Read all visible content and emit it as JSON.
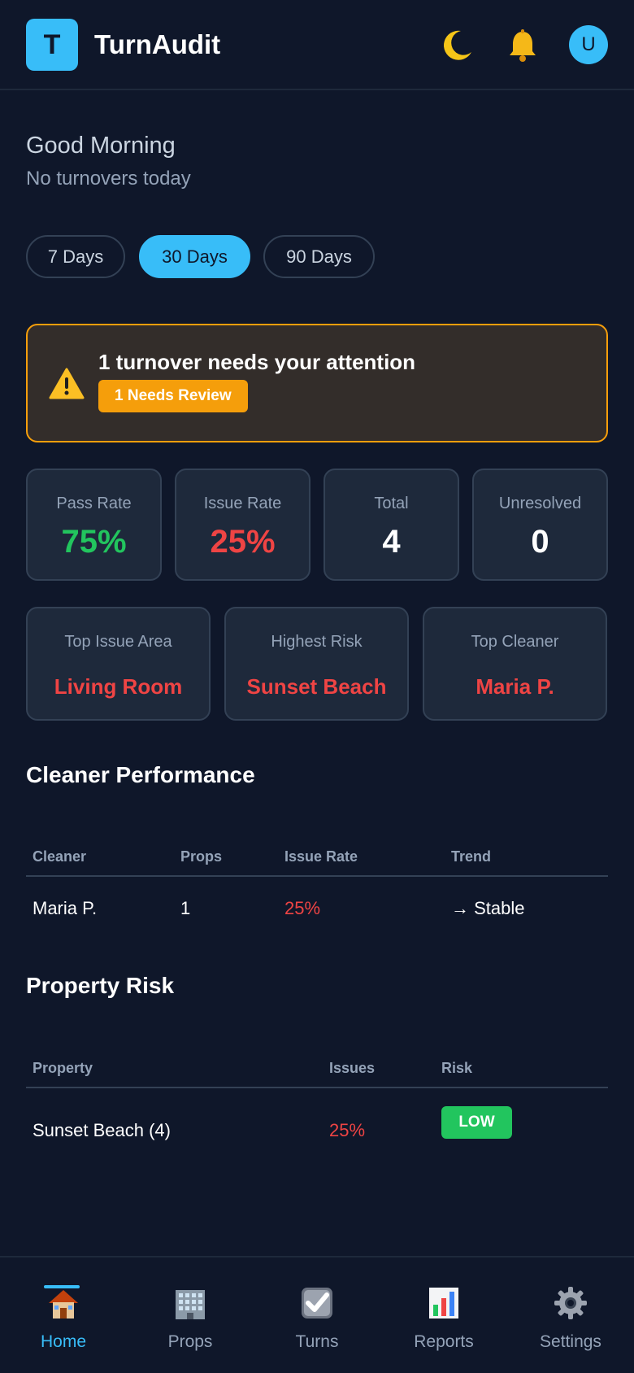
{
  "app": {
    "logo_letter": "T",
    "title": "TurnAudit",
    "avatar_letter": "U"
  },
  "greeting": {
    "title": "Good Morning",
    "subtitle": "No turnovers today"
  },
  "ranges": [
    {
      "label": "7 Days",
      "active": false
    },
    {
      "label": "30 Days",
      "active": true
    },
    {
      "label": "90 Days",
      "active": false
    }
  ],
  "alert": {
    "title": "1 turnover needs your attention",
    "badge": "1 Needs Review",
    "color": "#f59e0b"
  },
  "stats": [
    {
      "label": "Pass Rate",
      "value": "75%"
    },
    {
      "label": "Issue Rate",
      "value": "25%"
    },
    {
      "label": "Total",
      "value": "4"
    },
    {
      "label": "Unresolved",
      "value": "0"
    }
  ],
  "insights": [
    {
      "label": "Top Issue Area",
      "value": "Living Room"
    },
    {
      "label": "Highest Risk",
      "value": "Sunset Beach"
    },
    {
      "label": "Top Cleaner",
      "value": "Maria P."
    }
  ],
  "cleaner_performance": {
    "title": "Cleaner Performance",
    "headers": [
      "Cleaner",
      "Props",
      "Issue Rate",
      "Trend"
    ],
    "rows": [
      {
        "cleaner": "Maria P.",
        "props": "1",
        "issue_rate": "25%",
        "trend": "→ Stable"
      }
    ]
  },
  "property_risk": {
    "title": "Property Risk",
    "headers": [
      "Property",
      "Issues",
      "Risk"
    ],
    "rows": [
      {
        "property": "Sunset Beach (4)",
        "issues": "25%",
        "risk": "LOW"
      }
    ]
  },
  "nav": [
    {
      "label": "Home",
      "icon": "home-icon",
      "active": true
    },
    {
      "label": "Props",
      "icon": "building-icon",
      "active": false
    },
    {
      "label": "Turns",
      "icon": "checkbox-icon",
      "active": false
    },
    {
      "label": "Reports",
      "icon": "chart-icon",
      "active": false
    },
    {
      "label": "Settings",
      "icon": "gear-icon",
      "active": false
    }
  ],
  "colors": {
    "background": "#0f172a",
    "card": "#1e293b",
    "accent": "#38bdf8",
    "pass": "#22c55e",
    "issue": "#ef4444",
    "warning": "#f59e0b"
  }
}
